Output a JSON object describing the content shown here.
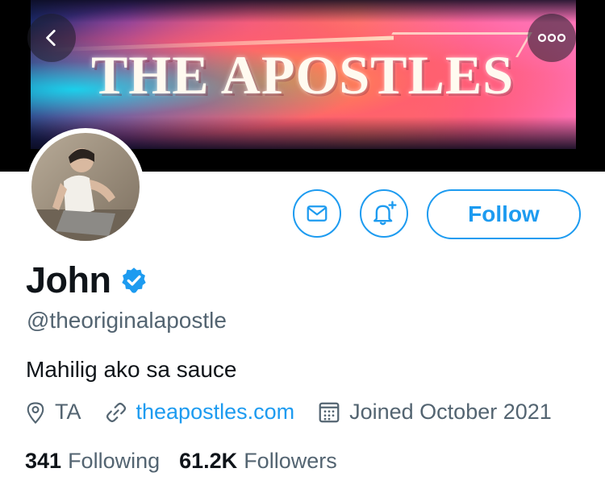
{
  "banner": {
    "title": "THE APOSTLES"
  },
  "header": {
    "back_icon": "chevron-left-icon",
    "more_icon": "more-horizontal-icon"
  },
  "actions": {
    "message_icon": "mail-icon",
    "notify_icon": "bell-plus-icon",
    "follow_label": "Follow"
  },
  "profile": {
    "name": "John",
    "verified": true,
    "handle": "@theoriginalapostle",
    "bio": "Mahilig ako sa sauce",
    "location": "TA",
    "website": "theapostles.com",
    "joined": "Joined October 2021"
  },
  "stats": {
    "following_count": "341",
    "following_label": "Following",
    "followers_count": "61.2K",
    "followers_label": "Followers"
  },
  "colors": {
    "accent": "#1d9bf0",
    "secondary_text": "#536471",
    "primary_text": "#0f1419"
  }
}
